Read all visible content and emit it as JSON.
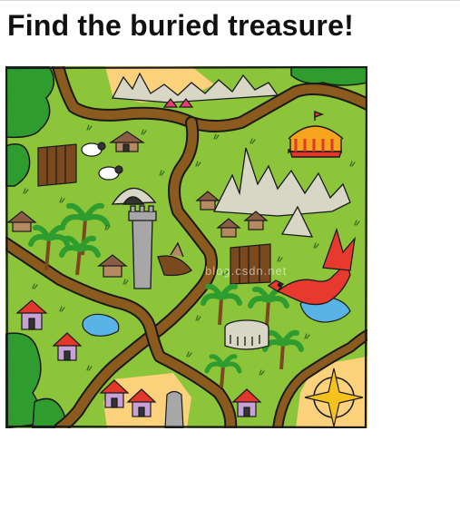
{
  "page": {
    "title": "Find the buried treasure!"
  },
  "map": {
    "watermark": "blog.csdn.net",
    "colors": {
      "grass": "#8cc43a",
      "path": "#8b5a1e",
      "sand": "#fcd17c",
      "water": "#5ab3e6",
      "trees": "#2e9c2e",
      "dragon": "#e8392f"
    }
  }
}
